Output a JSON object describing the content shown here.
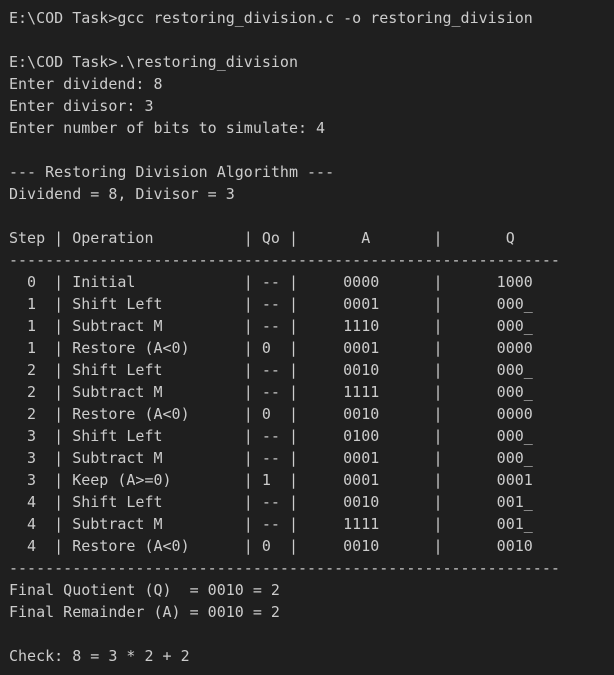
{
  "terminal": {
    "lines": [
      "E:\\COD Task>gcc restoring_division.c -o restoring_division",
      "",
      "E:\\COD Task>.\\restoring_division",
      "Enter dividend: 8",
      "Enter divisor: 3",
      "Enter number of bits to simulate: 4",
      "",
      "--- Restoring Division Algorithm ---",
      "Dividend = 8, Divisor = 3",
      "",
      "Step | Operation          | Qo |       A       |       Q",
      "-------------------------------------------------------------",
      "  0  | Initial            | -- |     0000      |      1000",
      "  1  | Shift Left         | -- |     0001      |      000_",
      "  1  | Subtract M         | -- |     1110      |      000_",
      "  1  | Restore (A<0)      | 0  |     0001      |      0000",
      "  2  | Shift Left         | -- |     0010      |      000_",
      "  2  | Subtract M         | -- |     1111      |      000_",
      "  2  | Restore (A<0)      | 0  |     0010      |      0000",
      "  3  | Shift Left         | -- |     0100      |      000_",
      "  3  | Subtract M         | -- |     0001      |      000_",
      "  3  | Keep (A>=0)        | 1  |     0001      |      0001",
      "  4  | Shift Left         | -- |     0010      |      001_",
      "  4  | Subtract M         | -- |     1111      |      001_",
      "  4  | Restore (A<0)      | 0  |     0010      |      0010",
      "-------------------------------------------------------------",
      "Final Quotient (Q)  = 0010 = 2",
      "Final Remainder (A) = 0010 = 2",
      "",
      "Check: 8 = 3 * 2 + 2"
    ]
  },
  "colors": {
    "background": "#1f1f1f",
    "text": "#cccccc"
  }
}
